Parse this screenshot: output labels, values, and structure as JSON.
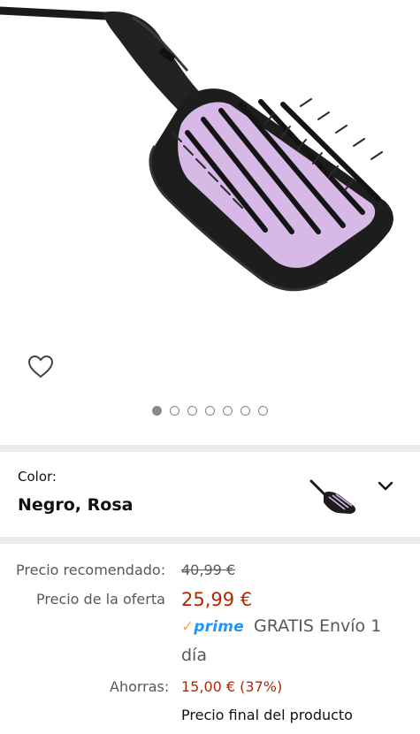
{
  "product": {
    "image_alt": "Philips hair straightening brush",
    "carousel": {
      "total": 7,
      "active": 0
    }
  },
  "variant": {
    "label": "Color:",
    "value": "Negro, Rosa"
  },
  "pricing": {
    "recommended_label": "Precio recomendado:",
    "recommended_value": "40,99 €",
    "deal_label": "Precio de la oferta",
    "deal_value": "25,99 €",
    "prime_check": "✓",
    "prime_text": "prime",
    "shipping_line1": "GRATIS Envío 1",
    "shipping_line2": "día",
    "savings_label": "Ahorras:",
    "savings_value": "15,00 € (37%)",
    "final_note": "Precio final del producto"
  },
  "icons": {
    "wishlist": "heart-outline-icon",
    "expand": "chevron-down-icon"
  },
  "colors": {
    "deal_red": "#b12704",
    "prime_blue": "#1a98ff",
    "prime_check": "#f7a847",
    "divider": "#e9ecec"
  }
}
